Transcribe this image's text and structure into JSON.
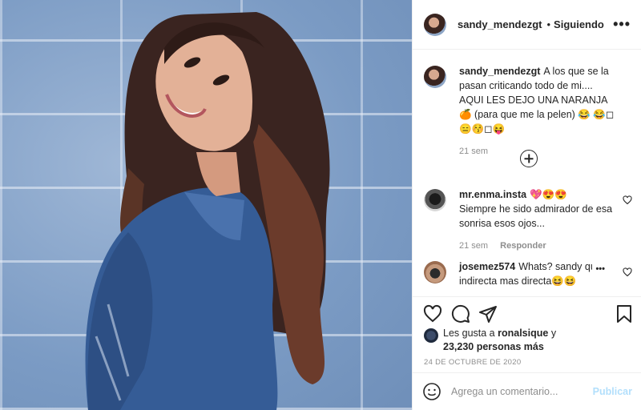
{
  "post": {
    "username": "sandy_mendezgt",
    "separator": "•",
    "follow_status": "Siguiendo",
    "more_glyph": "•••"
  },
  "caption": {
    "username": "sandy_mendezgt",
    "text": "A los que se la pasan criticando todo de mi.... AQUI LES DEJO UNA NARANJA 🍊 (para que me la pelen) 😂 😂◻😑😚◻😝",
    "time": "21 sem"
  },
  "comments": [
    {
      "username": "mr.enma.insta",
      "text_top": "💖😍😍",
      "text": "Siempre he sido admirador de esa sonrisa esos ojos...",
      "time": "21 sem",
      "reply_label": "Responder"
    },
    {
      "username": "josemez574",
      "text": "Whats? sandy que indirecta mas directa😆😆",
      "more_glyph": "•••"
    }
  ],
  "likes": {
    "prefix": "Les gusta a",
    "first_user": "ronalsique",
    "connector": "y",
    "count_text": "23,230 personas más"
  },
  "date": "24 DE OCTUBRE DE 2020",
  "composer": {
    "placeholder": "Agrega un comentario...",
    "publish_label": "Publicar"
  },
  "colors": {
    "publish_disabled": "#b2dffc",
    "secondary_text": "#8e8e8e",
    "border": "#efefef"
  }
}
